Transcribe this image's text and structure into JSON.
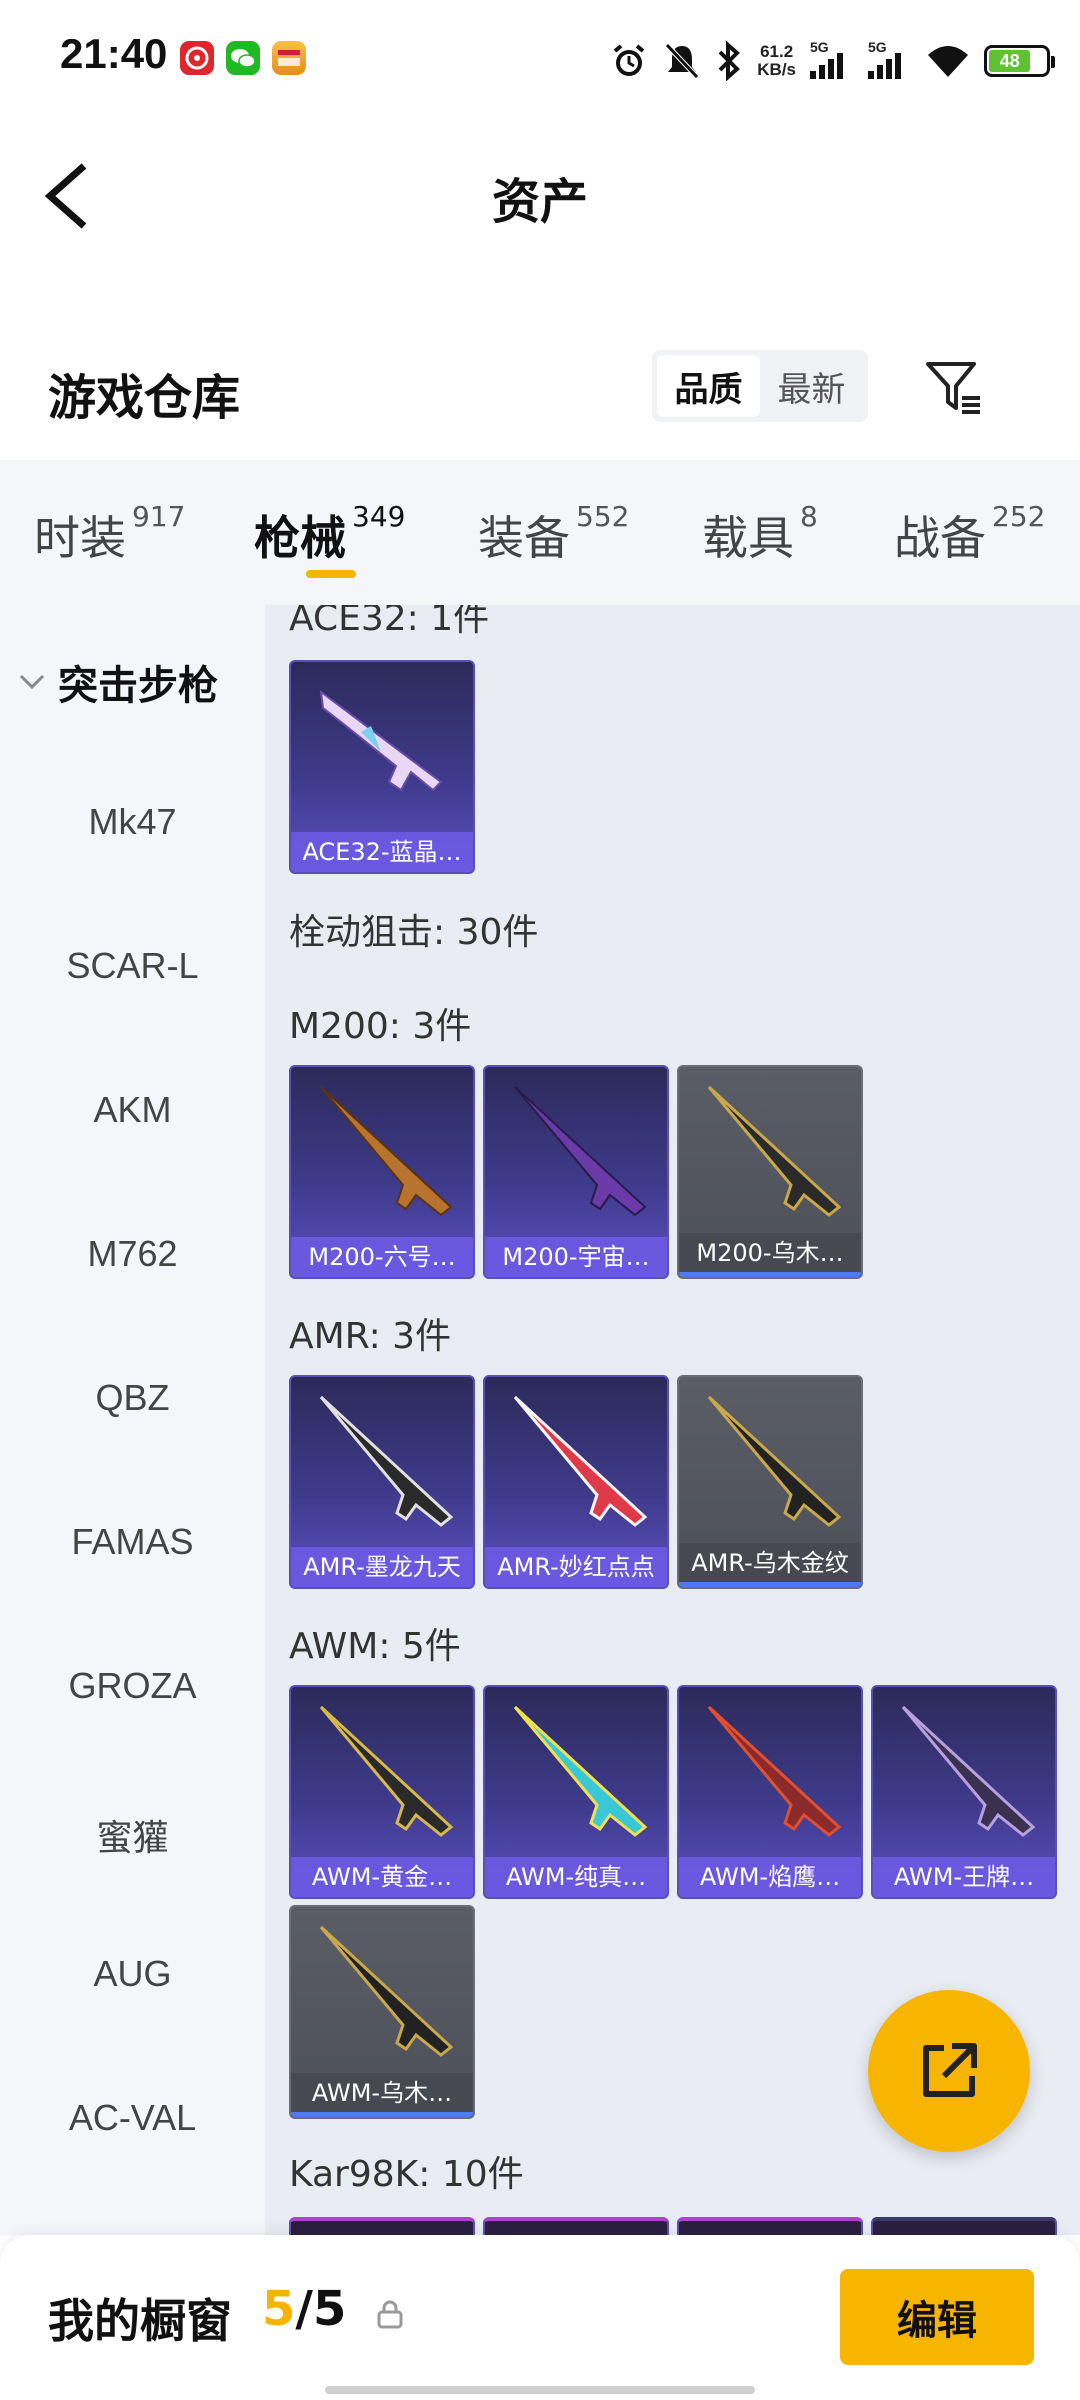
{
  "status_bar": {
    "time": "21:40",
    "net_speed_value": "61.2",
    "net_speed_unit": "KB/s",
    "sim1_label": "5G",
    "sim2_label": "5G",
    "battery": "48"
  },
  "header": {
    "title": "资产"
  },
  "section": {
    "title": "游戏仓库",
    "sort_options": [
      "品质",
      "最新"
    ],
    "sort_active": "品质"
  },
  "category_tabs": [
    {
      "label": "时装",
      "count": "917"
    },
    {
      "label": "枪械",
      "count": "349",
      "active": true
    },
    {
      "label": "装备",
      "count": "552"
    },
    {
      "label": "载具",
      "count": "8"
    },
    {
      "label": "战备",
      "count": "252"
    }
  ],
  "sidebar": {
    "group": "突击步枪",
    "items": [
      "Mk47",
      "SCAR-L",
      "AKM",
      "M762",
      "QBZ",
      "FAMAS",
      "GROZA",
      "蜜獾",
      "AUG",
      "AC-VAL"
    ]
  },
  "content": {
    "ace32_label": "ACE32: 1件",
    "ace32_items": [
      "ACE32-蓝晶…"
    ],
    "bolt_label": "栓动狙击: 30件",
    "m200_label": "M200: 3件",
    "m200_items": [
      "M200-六号…",
      "M200-宇宙…",
      "M200-乌木…"
    ],
    "amr_label": "AMR: 3件",
    "amr_items": [
      "AMR-墨龙九天",
      "AMR-妙红点点",
      "AMR-乌木金纹"
    ],
    "awm_label": "AWM: 5件",
    "awm_items": [
      "AWM-黄金…",
      "AWM-纯真…",
      "AWM-焰鹰…",
      "AWM-王牌…",
      "AWM-乌木…"
    ],
    "kar_label": "Kar98K: 10件"
  },
  "bottom_bar": {
    "label": "我的橱窗",
    "current": "5",
    "separator": "/",
    "total": "5",
    "edit_label": "编辑"
  },
  "colors": {
    "accent": "#f7b500",
    "card_purple": "#3e3a8a",
    "card_grey": "#4d5058",
    "background_panel": "#f4f6fa",
    "background_content": "#e9ecf2"
  }
}
